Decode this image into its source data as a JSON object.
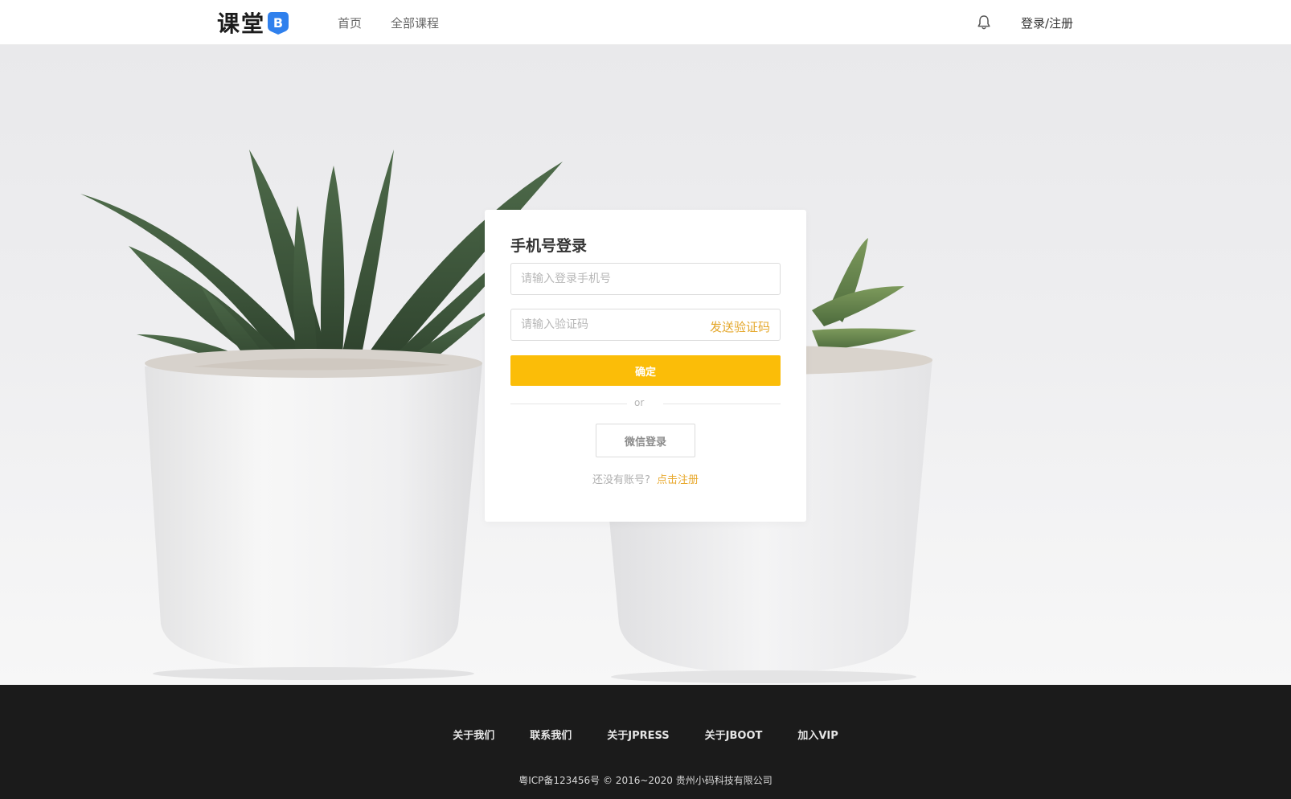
{
  "header": {
    "logo_text": "课堂",
    "logo_badge": "B",
    "nav": [
      "首页",
      "全部课程"
    ],
    "login_register": "登录/注册"
  },
  "login": {
    "title": "手机号登录",
    "phone_placeholder": "请输入登录手机号",
    "code_placeholder": "请输入验证码",
    "send_code": "发送验证码",
    "submit": "确定",
    "or": "or",
    "wechat": "微信登录",
    "no_account": "还没有账号?",
    "register": "点击注册"
  },
  "footer": {
    "links": [
      "关于我们",
      "联系我们",
      "关于JPRESS",
      "关于JBOOT",
      "加入VIP"
    ],
    "copyright": "粤ICP备123456号 © 2016~2020 贵州小码科技有限公司"
  },
  "colors": {
    "accent": "#fbbd08",
    "link": "#e4a72a",
    "brand_blue": "#2f80ed",
    "footer_bg": "#1b1b1b"
  }
}
